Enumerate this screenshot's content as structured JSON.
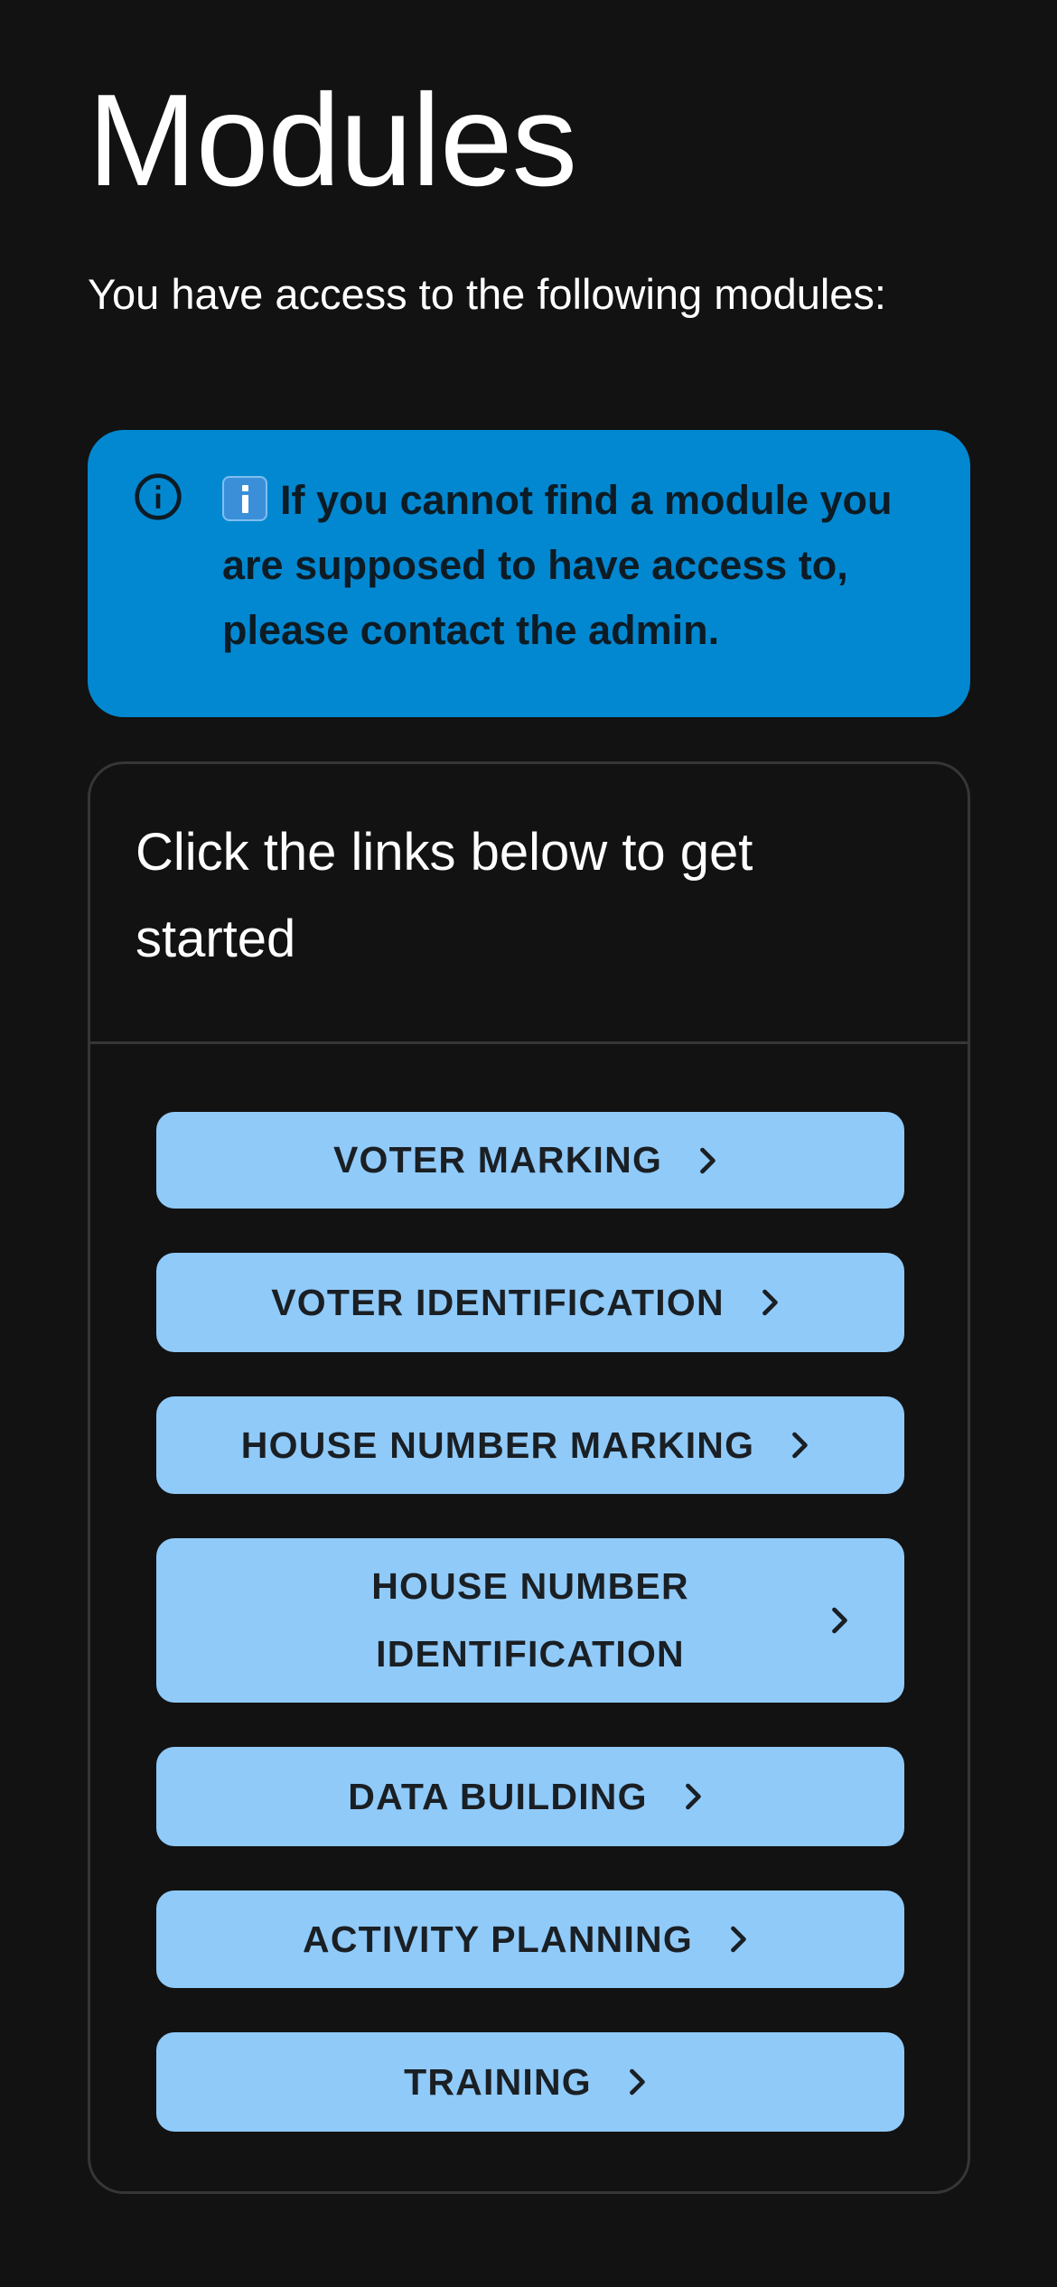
{
  "page": {
    "title": "Modules",
    "subtitle": "You have access to the following modules:"
  },
  "alert": {
    "icon": "info-outline-icon",
    "emoji": "information-emoji",
    "text": "If you cannot find a module you are supposed to have access to, please contact the admin.",
    "color": "#0288d1"
  },
  "card": {
    "title": "Click the links below to get started",
    "buttons": [
      {
        "label": "VOTER MARKING",
        "icon": "chevron-right-icon"
      },
      {
        "label": "VOTER IDENTIFICATION",
        "icon": "chevron-right-icon"
      },
      {
        "label": "HOUSE NUMBER MARKING",
        "icon": "chevron-right-icon"
      },
      {
        "label": "HOUSE NUMBER IDENTIFICATION",
        "icon": "chevron-right-icon"
      },
      {
        "label": "DATA BUILDING",
        "icon": "chevron-right-icon"
      },
      {
        "label": "ACTIVITY PLANNING",
        "icon": "chevron-right-icon"
      },
      {
        "label": "TRAINING",
        "icon": "chevron-right-icon"
      }
    ],
    "button_color": "#90caf9"
  },
  "colors": {
    "background": "#121212",
    "text": "#ffffff",
    "border": "#363636"
  }
}
